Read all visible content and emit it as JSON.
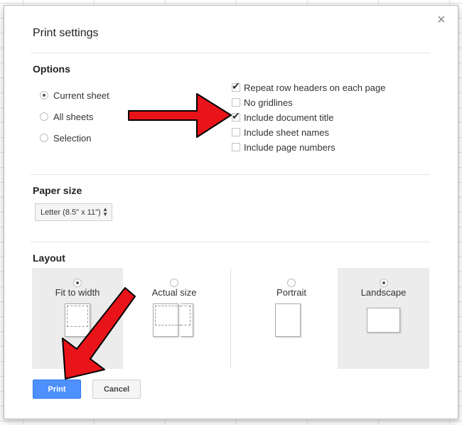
{
  "dialog": {
    "title": "Print settings",
    "close_icon": "×",
    "options": {
      "label": "Options",
      "scope": [
        {
          "label": "Current sheet",
          "selected": true
        },
        {
          "label": "All sheets",
          "selected": false
        },
        {
          "label": "Selection",
          "selected": false
        }
      ],
      "checks": [
        {
          "label": "Repeat row headers on each page",
          "checked": true
        },
        {
          "label": "No gridlines",
          "checked": false
        },
        {
          "label": "Include document title",
          "checked": true
        },
        {
          "label": "Include sheet names",
          "checked": false
        },
        {
          "label": "Include page numbers",
          "checked": false
        }
      ]
    },
    "paper_size": {
      "label": "Paper size",
      "value": "Letter (8.5\" x 11\")"
    },
    "layout": {
      "label": "Layout",
      "options": [
        {
          "label": "Fit to width",
          "selected": true
        },
        {
          "label": "Actual size",
          "selected": false
        },
        {
          "label": "Portrait",
          "selected": false
        },
        {
          "label": "Landscape",
          "selected": true
        }
      ]
    },
    "buttons": {
      "print": "Print",
      "cancel": "Cancel"
    }
  },
  "colors": {
    "accent": "#4d90fe",
    "annotation_arrow": "#e8141a"
  }
}
